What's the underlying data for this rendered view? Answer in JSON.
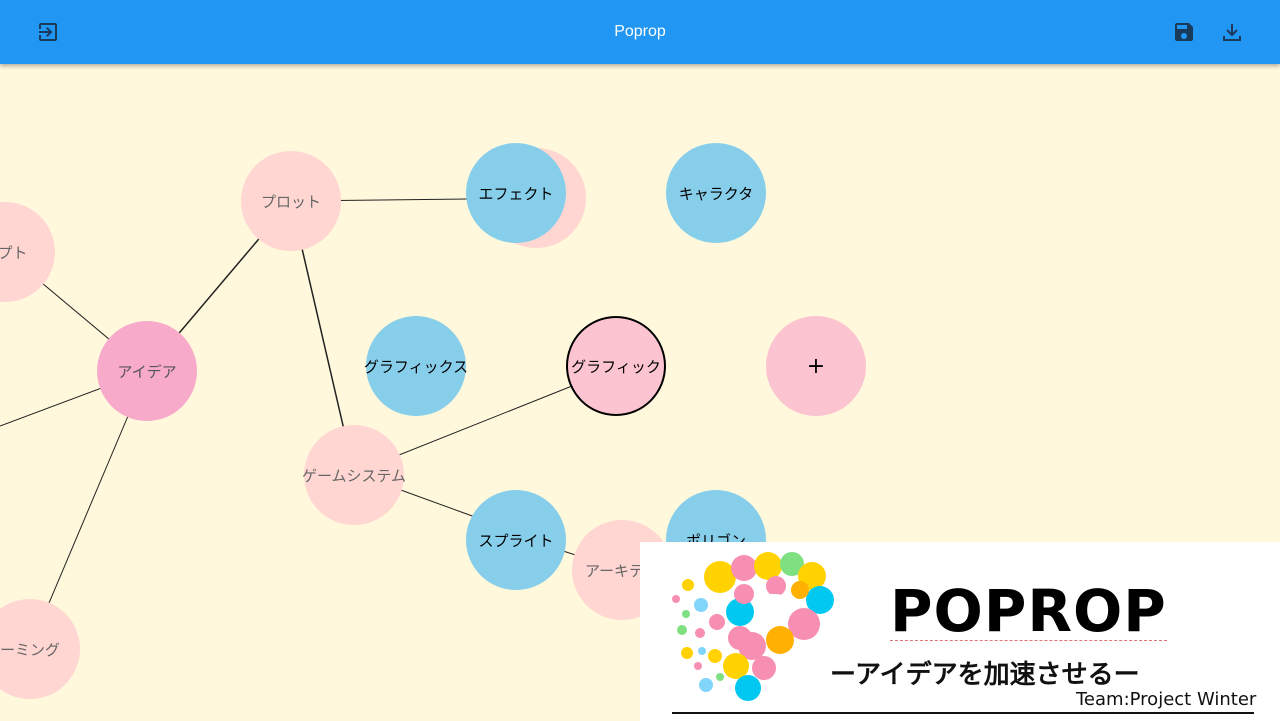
{
  "appbar": {
    "title": "Poprop",
    "color": "#2196f3",
    "left_icon": "exit-to-app-icon",
    "right_icons": [
      "save-icon",
      "download-icon"
    ]
  },
  "canvas": {
    "background": "#fff8dc",
    "nodes": {
      "concept": "セプト",
      "plot": "プロット",
      "effect": "エフェクト",
      "character": "キャラクタ",
      "idea": "アイデア",
      "graphics": "グラフィックス",
      "graphic": "グラフィック",
      "add": "+",
      "game_system": "ゲームシステム",
      "sprite": "スプライト",
      "architecture": "アーキテク",
      "polygon": "ポリゴン",
      "naming": "ーミング"
    },
    "node_colors": {
      "faded": "#ffd6d2",
      "hot": "#f8aacb",
      "blue": "#87ceeb",
      "pink": "#fbc4d0"
    }
  },
  "banner": {
    "title": "POPROP",
    "subtitle": "ーアイデアを加速させるー",
    "team": "Team:Project Winter",
    "logo": "poprop-dotted-p-logo"
  }
}
